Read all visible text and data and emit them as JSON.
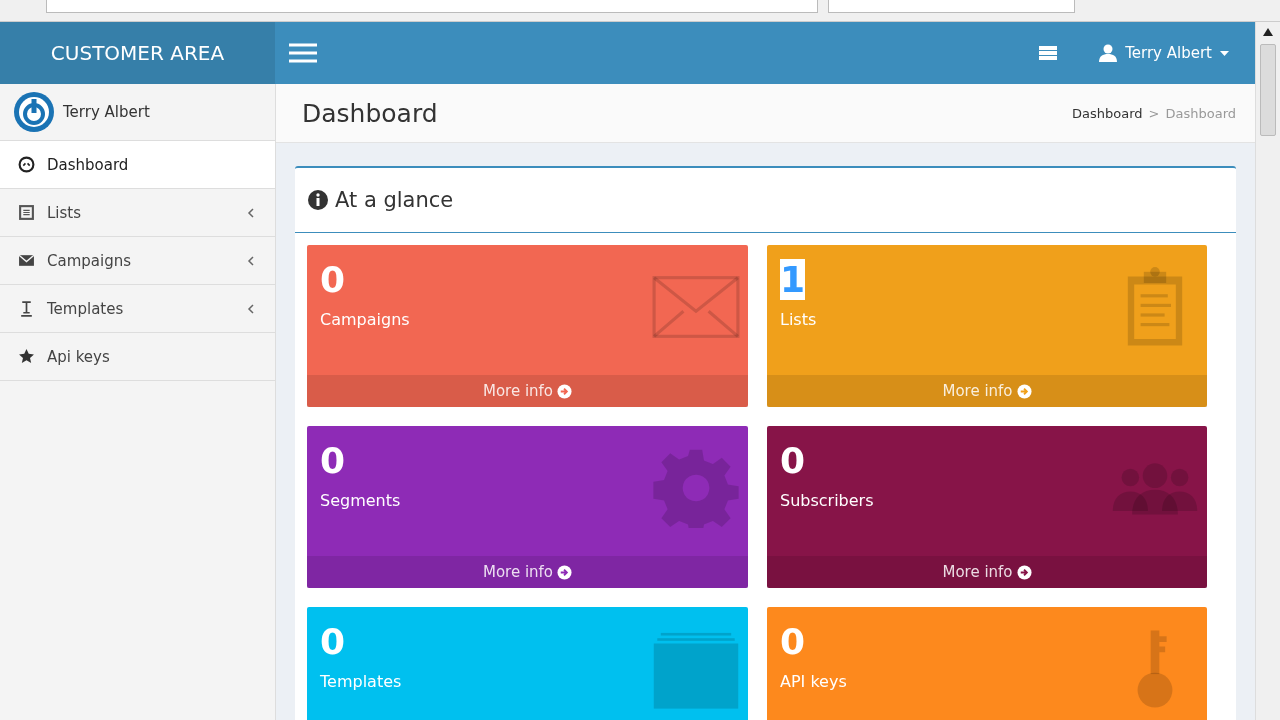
{
  "navbar": {
    "brand": "CUSTOMER AREA",
    "user": "Terry Albert"
  },
  "sidebar": {
    "user": "Terry Albert",
    "items": [
      {
        "label": "Dashboard",
        "kind": "dashboard",
        "selected": true,
        "has_submenu": false
      },
      {
        "label": "Lists",
        "kind": "lists",
        "selected": false,
        "has_submenu": true
      },
      {
        "label": "Campaigns",
        "kind": "campaigns",
        "selected": false,
        "has_submenu": true
      },
      {
        "label": "Templates",
        "kind": "templates",
        "selected": false,
        "has_submenu": true
      },
      {
        "label": "Api keys",
        "kind": "apikeys",
        "selected": false,
        "has_submenu": false
      }
    ]
  },
  "header": {
    "title": "Dashboard",
    "breadcrumb": [
      "Dashboard",
      "Dashboard"
    ],
    "breadcrumb_separator": ">"
  },
  "panel": {
    "title": "At a glance",
    "cards": [
      {
        "value": "0",
        "label": "Campaigns",
        "kind": "campaigns",
        "color": "#f26752",
        "value_selected": false,
        "footer": "More info"
      },
      {
        "value": "1",
        "label": "Lists",
        "kind": "lists",
        "color": "#f0a01b",
        "value_selected": true,
        "footer": "More info"
      },
      {
        "value": "0",
        "label": "Segments",
        "kind": "segments",
        "color": "#8e2bb6",
        "value_selected": false,
        "footer": "More info"
      },
      {
        "value": "0",
        "label": "Subscribers",
        "kind": "subscribers",
        "color": "#871448",
        "value_selected": false,
        "footer": "More info"
      },
      {
        "value": "0",
        "label": "Templates",
        "kind": "templates",
        "color": "#00c0ef",
        "value_selected": false
      },
      {
        "value": "0",
        "label": "API keys",
        "kind": "apikeys",
        "color": "#fd891d",
        "value_selected": false
      }
    ]
  }
}
